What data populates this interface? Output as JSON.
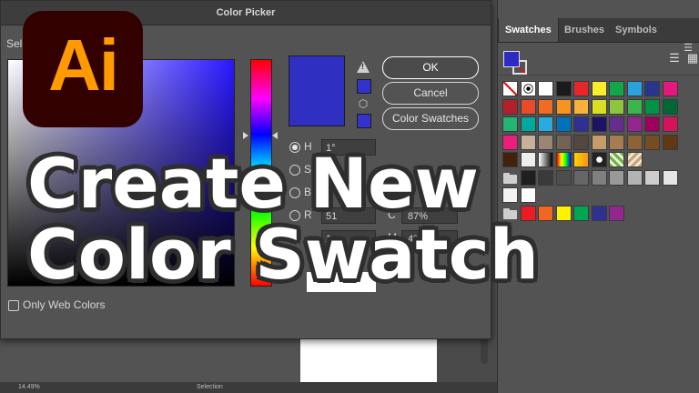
{
  "dialog": {
    "title": "Color Picker",
    "select_label": "Sele",
    "buttons": {
      "ok": "OK",
      "cancel": "Cancel",
      "color_swatches": "Color Swatches"
    },
    "only_web_colors": "Only Web Colors",
    "fields": {
      "h_label": "H",
      "h_value": "1°",
      "s_label": "S",
      "b_label": "B",
      "r_label": "R",
      "r_value": "51",
      "c_label": "C",
      "c_value": "87%",
      "m_label": "M",
      "m_value": "4%",
      "g_value": "1"
    },
    "current_color": "#2f2fc2"
  },
  "panel": {
    "tabs": [
      "Swatches",
      "Brushes",
      "Symbols"
    ],
    "menu_icon": "panel-menu-icon",
    "swatch_rows": [
      [
        "none",
        "registration",
        "#ffffff",
        "#1a1a1a",
        "#e8262a",
        "#f9ed2c",
        "#12a54a",
        "#2aa3dc",
        "#2a3590",
        "#e5187b"
      ],
      [
        "#b3202a",
        "#e84c2a",
        "#f26b22",
        "#f7931e",
        "#fbb03b",
        "#d9e021",
        "#8cc63f",
        "#39b54a",
        "#009245",
        "#006837"
      ],
      [
        "#22b573",
        "#00a99d",
        "#29abe2",
        "#0071bc",
        "#2e3192",
        "#1b1464",
        "#662d91",
        "#93278f",
        "#9e005d",
        "#d4145a"
      ],
      [
        "#ed1e79",
        "#c7b299",
        "#998675",
        "#736357",
        "#534741",
        "#c69c6d",
        "#a67c52",
        "#8c6239",
        "#754c24",
        "#603813"
      ],
      [
        "#42210b",
        "#eeeeee",
        "gradient-gray",
        "gradient-rainbow",
        "gradient-orange",
        "pattern-dots",
        "pattern-leaves",
        "pattern-tan"
      ],
      [
        "folder",
        "#1f1f1f",
        "#3a3a3a",
        "#4d4d4d",
        "#666666",
        "#808080",
        "#999999",
        "#b3b3b3",
        "#cccccc",
        "#e6e6e6"
      ],
      [
        "#f2f2f2",
        "#ffffff"
      ],
      [
        "folder",
        "#ed1c24",
        "#f26522",
        "#fff200",
        "#00a651",
        "#2e3192",
        "#92278f"
      ]
    ]
  },
  "status": {
    "zoom": "14.49%",
    "tool": "Selection"
  },
  "overlay": {
    "logo_text": "Ai",
    "headline_line1": "Create New",
    "headline_line2": "Color Swatch"
  }
}
